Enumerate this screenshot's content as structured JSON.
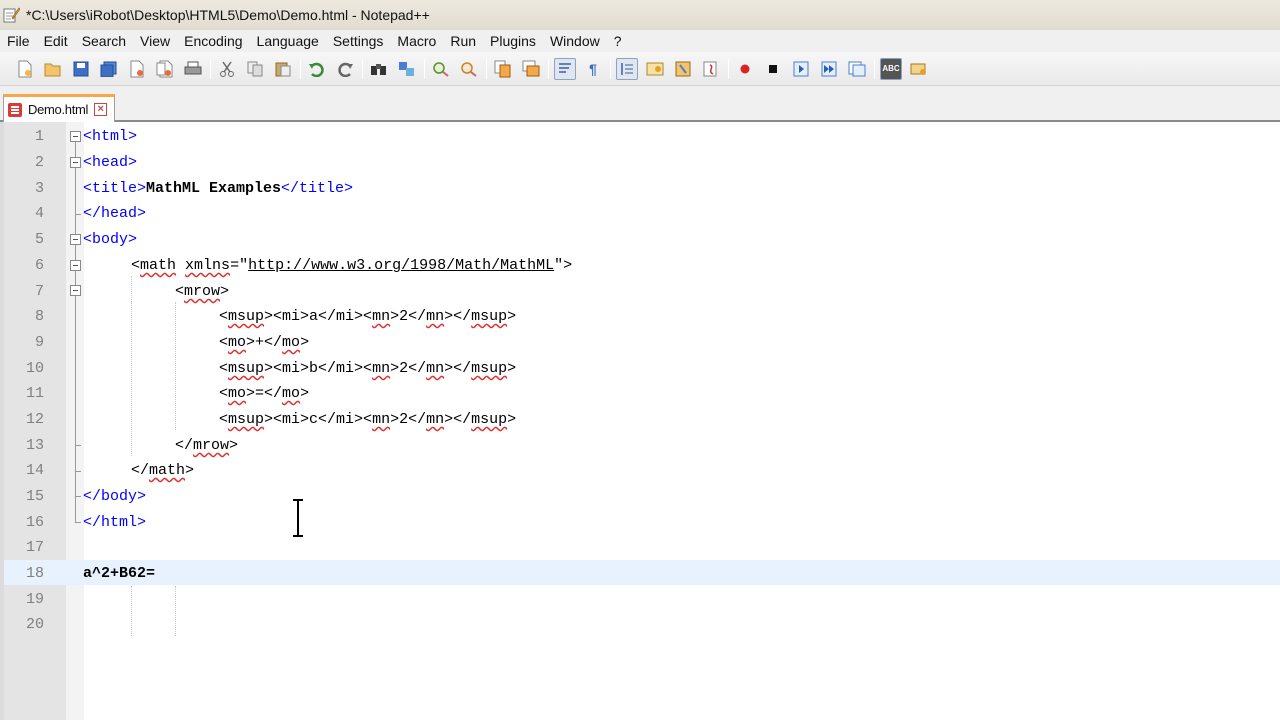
{
  "window": {
    "title": "*C:\\Users\\iRobot\\Desktop\\HTML5\\Demo\\Demo.html - Notepad++"
  },
  "menu": [
    "File",
    "Edit",
    "Search",
    "View",
    "Encoding",
    "Language",
    "Settings",
    "Macro",
    "Run",
    "Plugins",
    "Window",
    "?"
  ],
  "toolbar": {
    "buttons": [
      "new-file",
      "open-file",
      "save",
      "save-all",
      "close",
      "close-all",
      "print",
      "cut",
      "copy",
      "paste",
      "undo",
      "redo",
      "find",
      "replace",
      "zoom-in",
      "zoom-out",
      "sync-vertical",
      "sync-horizontal",
      "word-wrap",
      "show-all-characters",
      "indent-guide",
      "user-defined-language",
      "function-list",
      "doc-map",
      "start-recording",
      "stop-recording",
      "play-macro",
      "run-macro-multiple",
      "save-macro",
      "spell-check",
      "spell-check-options"
    ]
  },
  "tab": {
    "label": "Demo.html",
    "close_glyph": "×"
  },
  "editor": {
    "current_line": 18,
    "lines": [
      {
        "n": "1"
      },
      {
        "n": "2"
      },
      {
        "n": "3"
      },
      {
        "n": "4"
      },
      {
        "n": "5"
      },
      {
        "n": "6"
      },
      {
        "n": "7"
      },
      {
        "n": "8"
      },
      {
        "n": "9"
      },
      {
        "n": "10"
      },
      {
        "n": "11"
      },
      {
        "n": "12"
      },
      {
        "n": "13"
      },
      {
        "n": "14"
      },
      {
        "n": "15"
      },
      {
        "n": "16"
      },
      {
        "n": "17"
      },
      {
        "n": "18"
      },
      {
        "n": "19"
      },
      {
        "n": "20"
      }
    ],
    "code": {
      "l1": [
        "<html>"
      ],
      "l2": [
        "<head>"
      ],
      "l3": [
        "<title>",
        "MathML Examples",
        "</title>"
      ],
      "l4": [
        "</head>"
      ],
      "l5": [
        "<body>"
      ],
      "l6": [
        "<",
        "math",
        " ",
        "xmlns",
        "=\"",
        "http://www.w3.org/1998/Math/MathML",
        "\">"
      ],
      "l7": [
        "<",
        "mrow",
        ">"
      ],
      "l8": [
        "<",
        "msup",
        "><mi>a</mi><",
        "mn",
        ">2</",
        "mn",
        "></",
        "msup",
        ">"
      ],
      "l9": [
        "<",
        "mo",
        ">+</",
        "mo",
        ">"
      ],
      "l10": [
        "<",
        "msup",
        "><mi>b</mi><",
        "mn",
        ">2</",
        "mn",
        "></",
        "msup",
        ">"
      ],
      "l11": [
        "<",
        "mo",
        ">=</",
        "mo",
        ">"
      ],
      "l12": [
        "<",
        "msup",
        "><mi>c</mi><",
        "mn",
        ">2</",
        "mn",
        "></",
        "msup",
        ">"
      ],
      "l13": [
        "</",
        "mrow",
        ">"
      ],
      "l14": [
        "</",
        "math",
        ">"
      ],
      "l15": [
        "</body>"
      ],
      "l16": [
        "</html>"
      ],
      "l18": [
        "a^2+B62="
      ]
    }
  }
}
